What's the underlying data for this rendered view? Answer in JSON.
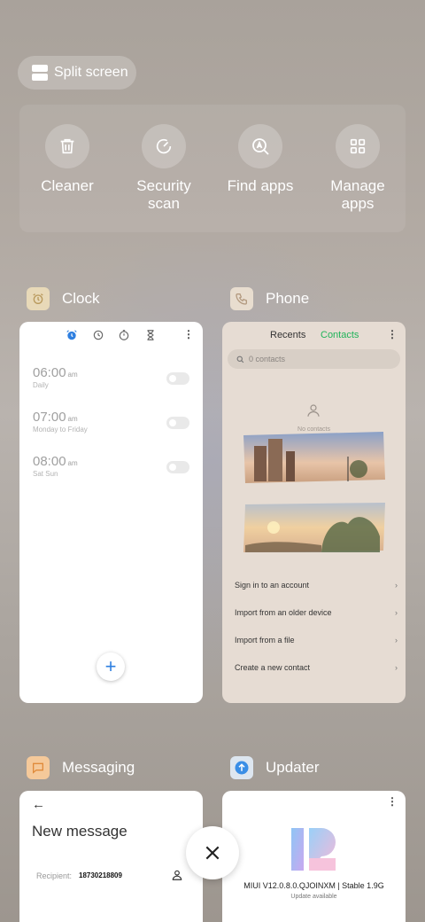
{
  "split_screen": {
    "label": "Split screen"
  },
  "tools": [
    {
      "label": "Cleaner",
      "icon": "trash-icon"
    },
    {
      "label": "Security scan",
      "icon": "security-scan-icon"
    },
    {
      "label": "Find apps",
      "icon": "find-apps-icon"
    },
    {
      "label": "Manage apps",
      "icon": "grid-icon"
    }
  ],
  "apps": {
    "clock": {
      "name": "Clock",
      "alarms": [
        {
          "time": "06:00",
          "ampm": "am",
          "repeat": "Daily"
        },
        {
          "time": "07:00",
          "ampm": "am",
          "repeat": "Monday to Friday"
        },
        {
          "time": "08:00",
          "ampm": "am",
          "repeat": "Sat Sun"
        }
      ]
    },
    "phone": {
      "name": "Phone",
      "tab_recents": "Recents",
      "tab_contacts": "Contacts",
      "search_placeholder": "0 contacts",
      "empty_text": "No contacts",
      "rows": [
        "Sign in to an account",
        "Import from an older device",
        "Import from a file",
        "Create a new contact"
      ]
    },
    "messaging": {
      "name": "Messaging",
      "title": "New message",
      "recipient_label": "Recipient:",
      "recipient_value": "18730218809"
    },
    "updater": {
      "name": "Updater",
      "version": "MIUI V12.0.8.0.QJOINXM | Stable 1.9G",
      "status": "Update available"
    }
  },
  "colors": {
    "accent_blue": "#2e7fe0",
    "contacts_green": "#21b35a"
  }
}
